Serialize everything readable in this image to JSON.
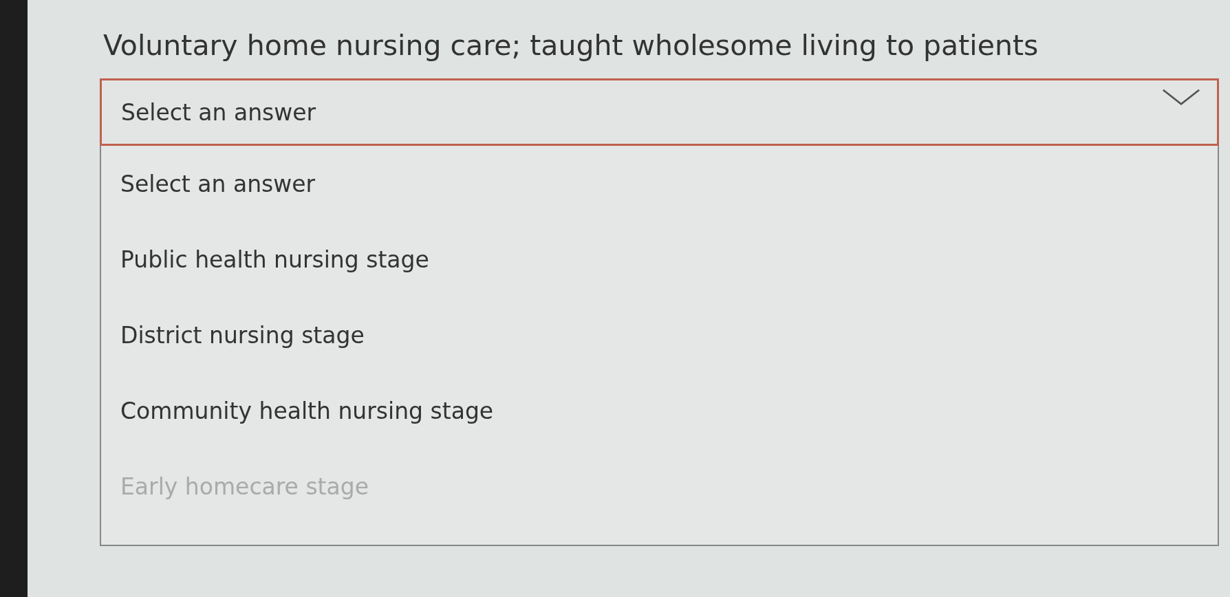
{
  "question": "Voluntary home nursing care; taught wholesome living to patients",
  "select": {
    "value": "Select an answer",
    "expanded": true
  },
  "options": [
    {
      "label": "Select an answer",
      "disabled": false
    },
    {
      "label": "Public health nursing stage",
      "disabled": false
    },
    {
      "label": "District nursing stage",
      "disabled": false
    },
    {
      "label": "Community health nursing stage",
      "disabled": false
    },
    {
      "label": "Early homecare stage",
      "disabled": true
    }
  ]
}
